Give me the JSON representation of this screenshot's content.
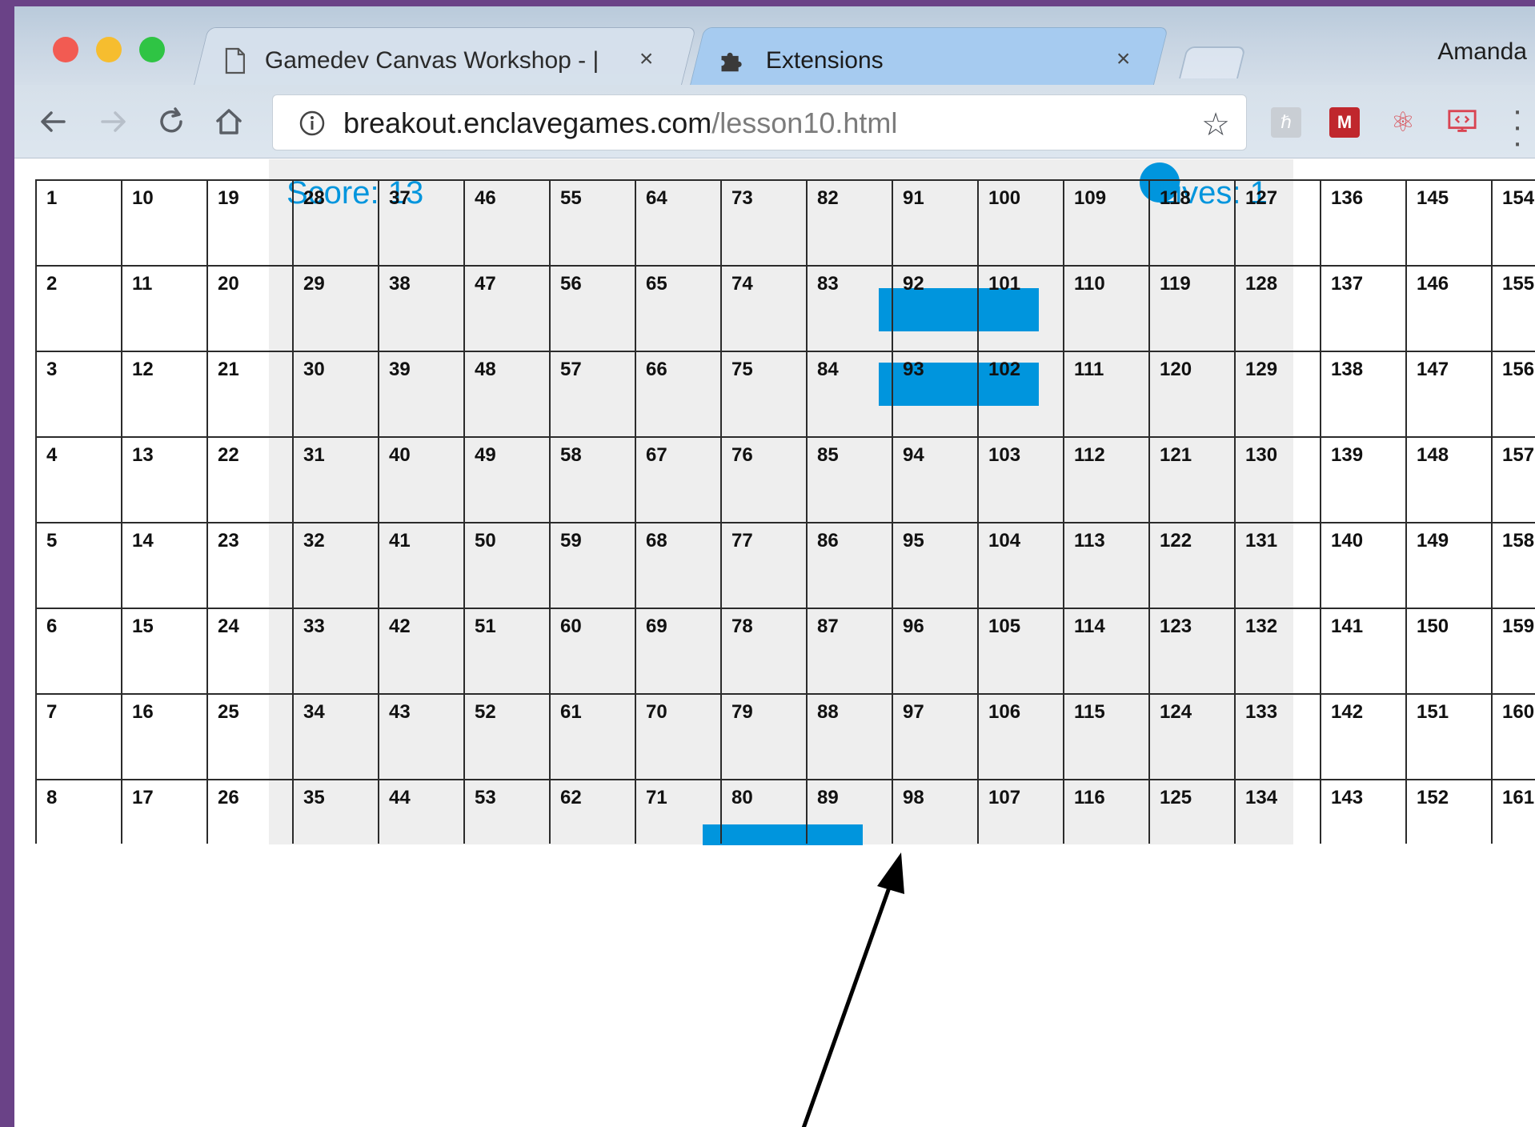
{
  "browser": {
    "tabs": [
      {
        "title": "Gamedev Canvas Workshop - |",
        "close": "×",
        "icon": "document-icon"
      },
      {
        "title": "Extensions",
        "close": "×",
        "icon": "puzzle-icon"
      }
    ],
    "profile_name": "Amanda",
    "address": {
      "host": "breakout.enclavegames.com",
      "path": "/lesson10.html"
    },
    "extensions": [
      "ext-h-icon",
      "ext-m-icon",
      "ext-atom-icon",
      "ext-devtools-icon"
    ]
  },
  "game": {
    "score_text": "Score: 13",
    "lives_text": "Lives: 1",
    "colors": {
      "bricks": "#0095dd",
      "canvas_bg": "#eeeeee"
    }
  },
  "overlay_grid": {
    "columns": [
      [
        "1",
        "2",
        "3",
        "4",
        "5",
        "6",
        "7",
        "8"
      ],
      [
        "10",
        "11",
        "12",
        "13",
        "14",
        "15",
        "16",
        "17"
      ],
      [
        "19",
        "20",
        "21",
        "22",
        "23",
        "24",
        "25",
        "26"
      ],
      [
        "28",
        "29",
        "30",
        "31",
        "32",
        "33",
        "34",
        "35"
      ],
      [
        "37",
        "38",
        "39",
        "40",
        "41",
        "42",
        "43",
        "44"
      ],
      [
        "46",
        "47",
        "48",
        "49",
        "50",
        "51",
        "52",
        "53"
      ],
      [
        "55",
        "56",
        "57",
        "58",
        "59",
        "60",
        "61",
        "62"
      ],
      [
        "64",
        "65",
        "66",
        "67",
        "68",
        "69",
        "70",
        "71"
      ],
      [
        "73",
        "74",
        "75",
        "76",
        "77",
        "78",
        "79",
        "80"
      ],
      [
        "82",
        "83",
        "84",
        "85",
        "86",
        "87",
        "88",
        "89"
      ],
      [
        "91",
        "92",
        "93",
        "94",
        "95",
        "96",
        "97",
        "98"
      ],
      [
        "100",
        "101",
        "102",
        "103",
        "104",
        "105",
        "106",
        "107"
      ],
      [
        "109",
        "110",
        "111",
        "112",
        "113",
        "114",
        "115",
        "116"
      ],
      [
        "118",
        "119",
        "120",
        "121",
        "122",
        "123",
        "124",
        "125"
      ],
      [
        "127",
        "128",
        "129",
        "130",
        "131",
        "132",
        "133",
        "134"
      ],
      [
        "136",
        "137",
        "138",
        "139",
        "140",
        "141",
        "142",
        "143"
      ],
      [
        "145",
        "146",
        "147",
        "148",
        "149",
        "150",
        "151",
        "152"
      ],
      [
        "154",
        "155",
        "156",
        "157",
        "158",
        "159",
        "160",
        "161"
      ]
    ]
  }
}
